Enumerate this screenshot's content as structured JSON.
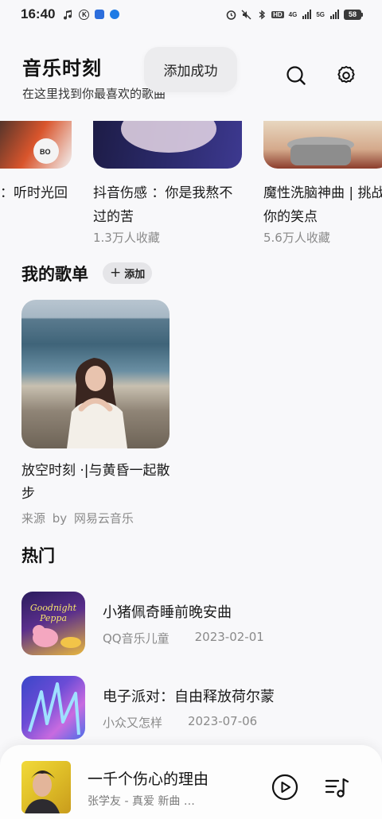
{
  "status_bar": {
    "time": "16:40",
    "k_icon_letter": "K",
    "network_1": "4G",
    "network_2": "5G",
    "hd_label": "HD",
    "battery": "58"
  },
  "header": {
    "title": "音乐时刻",
    "subtitle": "在这里找到你最喜欢的歌曲",
    "toast": "添加成功"
  },
  "carousel": [
    {
      "title": "：听时光回",
      "subtitle": ""
    },
    {
      "title": "抖音伤感 ：你是我熬不过的苦",
      "subtitle": "1.3万人收藏"
    },
    {
      "title": "魔性洗脑神曲 | 挑战你的笑点",
      "subtitle": "5.6万人收藏"
    }
  ],
  "my_playlists": {
    "section_title": "我的歌单",
    "add_label": "添加",
    "items": [
      {
        "title": "放空时刻 ·|与黄昏一起散步",
        "source": "来源 by 网易云音乐"
      }
    ]
  },
  "hot": {
    "section_title": "热门",
    "items": [
      {
        "title": "小猪佩奇睡前晚安曲",
        "author": "QQ音乐儿童",
        "date": "2023-02-01",
        "cover_text_1": "Goodnight",
        "cover_text_2": "Peppa"
      },
      {
        "title": "电子派对：自由释放荷尔蒙",
        "author": "小众又怎样",
        "date": "2023-07-06"
      }
    ]
  },
  "player": {
    "title": "一千个伤心的理由",
    "meta": "张学友 - 真爱 新曲 …"
  },
  "colors": {
    "accent": "#1e7be5",
    "text_secondary": "#8a8a8a",
    "background": "#f8f8fa"
  }
}
